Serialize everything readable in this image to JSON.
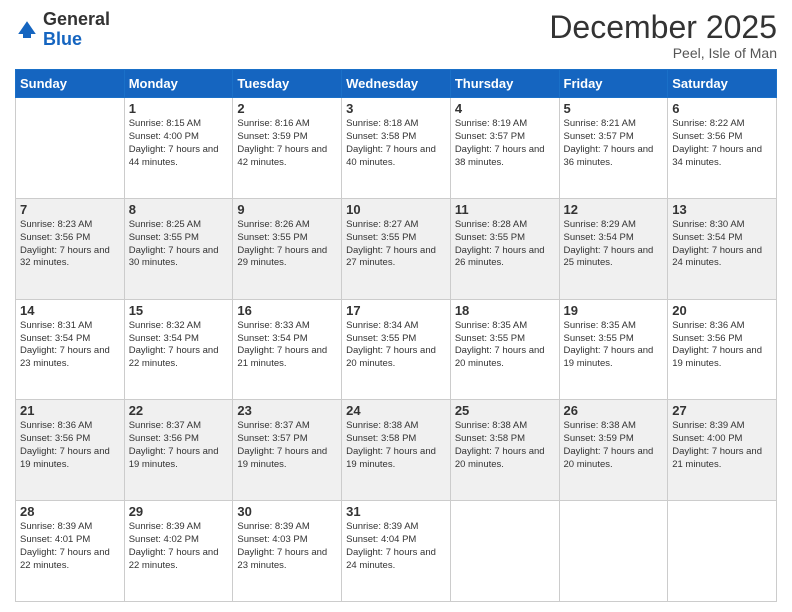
{
  "logo": {
    "general": "General",
    "blue": "Blue"
  },
  "header": {
    "month": "December 2025",
    "location": "Peel, Isle of Man"
  },
  "weekdays": [
    "Sunday",
    "Monday",
    "Tuesday",
    "Wednesday",
    "Thursday",
    "Friday",
    "Saturday"
  ],
  "weeks": [
    [
      null,
      {
        "day": 1,
        "sunrise": "8:15 AM",
        "sunset": "4:00 PM",
        "daylight": "7 hours and 44 minutes."
      },
      {
        "day": 2,
        "sunrise": "8:16 AM",
        "sunset": "3:59 PM",
        "daylight": "7 hours and 42 minutes."
      },
      {
        "day": 3,
        "sunrise": "8:18 AM",
        "sunset": "3:58 PM",
        "daylight": "7 hours and 40 minutes."
      },
      {
        "day": 4,
        "sunrise": "8:19 AM",
        "sunset": "3:57 PM",
        "daylight": "7 hours and 38 minutes."
      },
      {
        "day": 5,
        "sunrise": "8:21 AM",
        "sunset": "3:57 PM",
        "daylight": "7 hours and 36 minutes."
      },
      {
        "day": 6,
        "sunrise": "8:22 AM",
        "sunset": "3:56 PM",
        "daylight": "7 hours and 34 minutes."
      }
    ],
    [
      {
        "day": 7,
        "sunrise": "8:23 AM",
        "sunset": "3:56 PM",
        "daylight": "7 hours and 32 minutes."
      },
      {
        "day": 8,
        "sunrise": "8:25 AM",
        "sunset": "3:55 PM",
        "daylight": "7 hours and 30 minutes."
      },
      {
        "day": 9,
        "sunrise": "8:26 AM",
        "sunset": "3:55 PM",
        "daylight": "7 hours and 29 minutes."
      },
      {
        "day": 10,
        "sunrise": "8:27 AM",
        "sunset": "3:55 PM",
        "daylight": "7 hours and 27 minutes."
      },
      {
        "day": 11,
        "sunrise": "8:28 AM",
        "sunset": "3:55 PM",
        "daylight": "7 hours and 26 minutes."
      },
      {
        "day": 12,
        "sunrise": "8:29 AM",
        "sunset": "3:54 PM",
        "daylight": "7 hours and 25 minutes."
      },
      {
        "day": 13,
        "sunrise": "8:30 AM",
        "sunset": "3:54 PM",
        "daylight": "7 hours and 24 minutes."
      }
    ],
    [
      {
        "day": 14,
        "sunrise": "8:31 AM",
        "sunset": "3:54 PM",
        "daylight": "7 hours and 23 minutes."
      },
      {
        "day": 15,
        "sunrise": "8:32 AM",
        "sunset": "3:54 PM",
        "daylight": "7 hours and 22 minutes."
      },
      {
        "day": 16,
        "sunrise": "8:33 AM",
        "sunset": "3:54 PM",
        "daylight": "7 hours and 21 minutes."
      },
      {
        "day": 17,
        "sunrise": "8:34 AM",
        "sunset": "3:55 PM",
        "daylight": "7 hours and 20 minutes."
      },
      {
        "day": 18,
        "sunrise": "8:35 AM",
        "sunset": "3:55 PM",
        "daylight": "7 hours and 20 minutes."
      },
      {
        "day": 19,
        "sunrise": "8:35 AM",
        "sunset": "3:55 PM",
        "daylight": "7 hours and 19 minutes."
      },
      {
        "day": 20,
        "sunrise": "8:36 AM",
        "sunset": "3:56 PM",
        "daylight": "7 hours and 19 minutes."
      }
    ],
    [
      {
        "day": 21,
        "sunrise": "8:36 AM",
        "sunset": "3:56 PM",
        "daylight": "7 hours and 19 minutes."
      },
      {
        "day": 22,
        "sunrise": "8:37 AM",
        "sunset": "3:56 PM",
        "daylight": "7 hours and 19 minutes."
      },
      {
        "day": 23,
        "sunrise": "8:37 AM",
        "sunset": "3:57 PM",
        "daylight": "7 hours and 19 minutes."
      },
      {
        "day": 24,
        "sunrise": "8:38 AM",
        "sunset": "3:58 PM",
        "daylight": "7 hours and 19 minutes."
      },
      {
        "day": 25,
        "sunrise": "8:38 AM",
        "sunset": "3:58 PM",
        "daylight": "7 hours and 20 minutes."
      },
      {
        "day": 26,
        "sunrise": "8:38 AM",
        "sunset": "3:59 PM",
        "daylight": "7 hours and 20 minutes."
      },
      {
        "day": 27,
        "sunrise": "8:39 AM",
        "sunset": "4:00 PM",
        "daylight": "7 hours and 21 minutes."
      }
    ],
    [
      {
        "day": 28,
        "sunrise": "8:39 AM",
        "sunset": "4:01 PM",
        "daylight": "7 hours and 22 minutes."
      },
      {
        "day": 29,
        "sunrise": "8:39 AM",
        "sunset": "4:02 PM",
        "daylight": "7 hours and 22 minutes."
      },
      {
        "day": 30,
        "sunrise": "8:39 AM",
        "sunset": "4:03 PM",
        "daylight": "7 hours and 23 minutes."
      },
      {
        "day": 31,
        "sunrise": "8:39 AM",
        "sunset": "4:04 PM",
        "daylight": "7 hours and 24 minutes."
      },
      null,
      null,
      null
    ]
  ],
  "labels": {
    "sunrise": "Sunrise:",
    "sunset": "Sunset:",
    "daylight": "Daylight:"
  }
}
